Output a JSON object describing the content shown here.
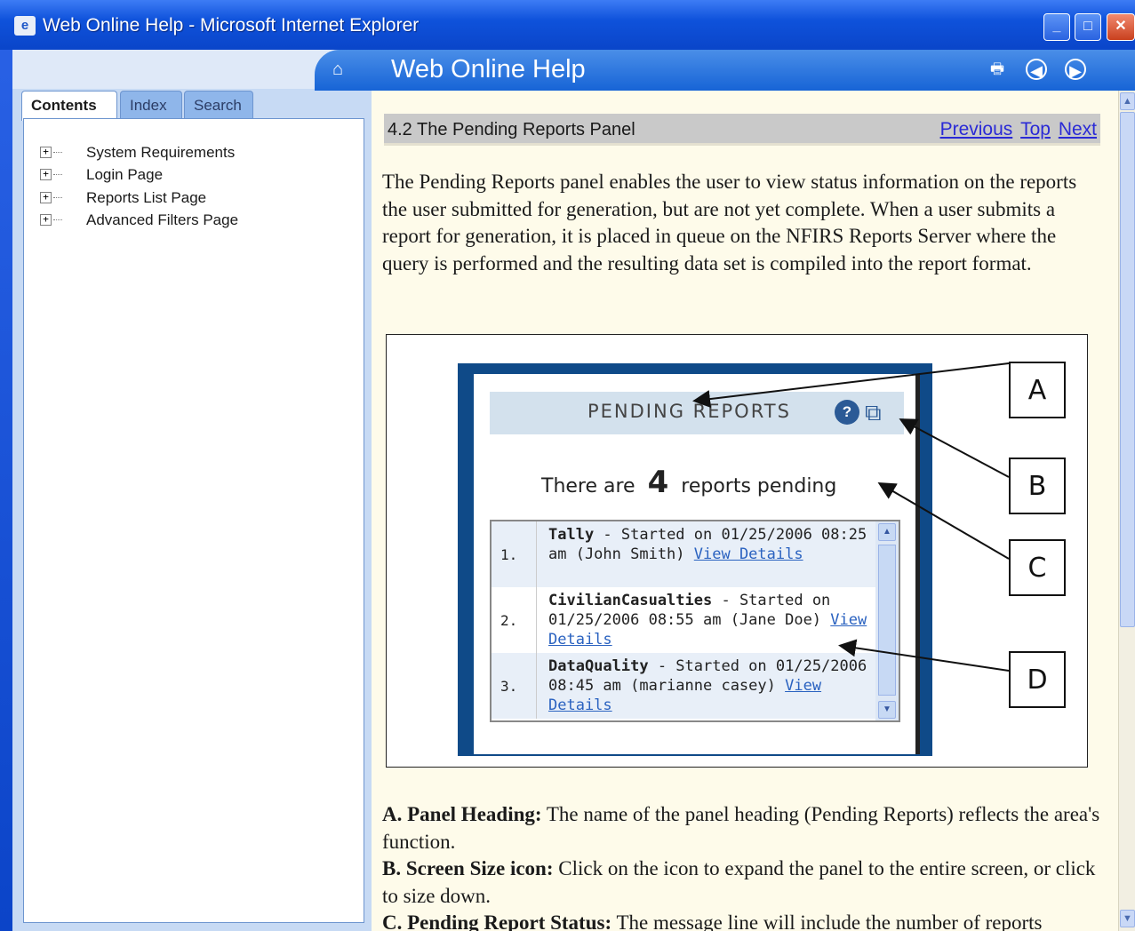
{
  "window": {
    "title": "Web Online Help - Microsoft Internet Explorer"
  },
  "left_pane": {
    "tabs": [
      {
        "label": "Contents",
        "active": true
      },
      {
        "label": "Index",
        "active": false
      },
      {
        "label": "Search",
        "active": false
      }
    ],
    "toc": [
      {
        "label": "System Requirements"
      },
      {
        "label": "Login Page"
      },
      {
        "label": "Reports List Page"
      },
      {
        "label": "Advanced Filters Page"
      }
    ]
  },
  "header": {
    "title": "Web Online Help"
  },
  "section": {
    "title": "4.2  The Pending Reports Panel",
    "nav": {
      "previous": "Previous",
      "top": "Top",
      "next": "Next"
    }
  },
  "intro": "The Pending Reports panel enables the user to view status information on the reports the user submitted for generation, but are not yet complete.  When a user submits a report for generation, it is placed in queue on the NFIRS Reports Server where the query is performed and the resulting data set is compiled into the report format.",
  "figure": {
    "panel_heading": "PENDING REPORTS",
    "pending_prefix": "There are",
    "pending_count": "4",
    "pending_suffix": "reports pending",
    "rows": [
      {
        "num": "1.",
        "name": "Tally",
        "pre": " - Started on 01/25/2006 08:25 am (John Smith) ",
        "link": "View Details"
      },
      {
        "num": "2.",
        "name": "CivilianCasualties",
        "pre": " - Started on 01/25/2006 08:55 am (Jane Doe) ",
        "link": "View Details"
      },
      {
        "num": "3.",
        "name": "DataQuality",
        "pre": " - Started on 01/25/2006 08:45 am (marianne casey) ",
        "link": "View Details"
      }
    ],
    "callouts": [
      "A",
      "B",
      "C",
      "D"
    ]
  },
  "descriptions": [
    {
      "term": "A. Panel Heading:",
      "text": " The name of the panel heading (Pending Reports)  reflects the area's function."
    },
    {
      "term": "B. Screen Size icon:",
      "text": " Click on the icon to expand the panel to the entire screen, or click to size down."
    },
    {
      "term": "C. Pending Report Status:",
      "text": " The message line will include the number of reports"
    }
  ],
  "icons": {
    "title": "ie-page-icon",
    "home": "home-icon",
    "print": "print-icon",
    "back": "back-circle-icon",
    "forward": "forward-circle-icon"
  },
  "colors": {
    "header_blue": "#1764d6",
    "content_bg": "#fefbea",
    "link": "#2a2ad6"
  }
}
